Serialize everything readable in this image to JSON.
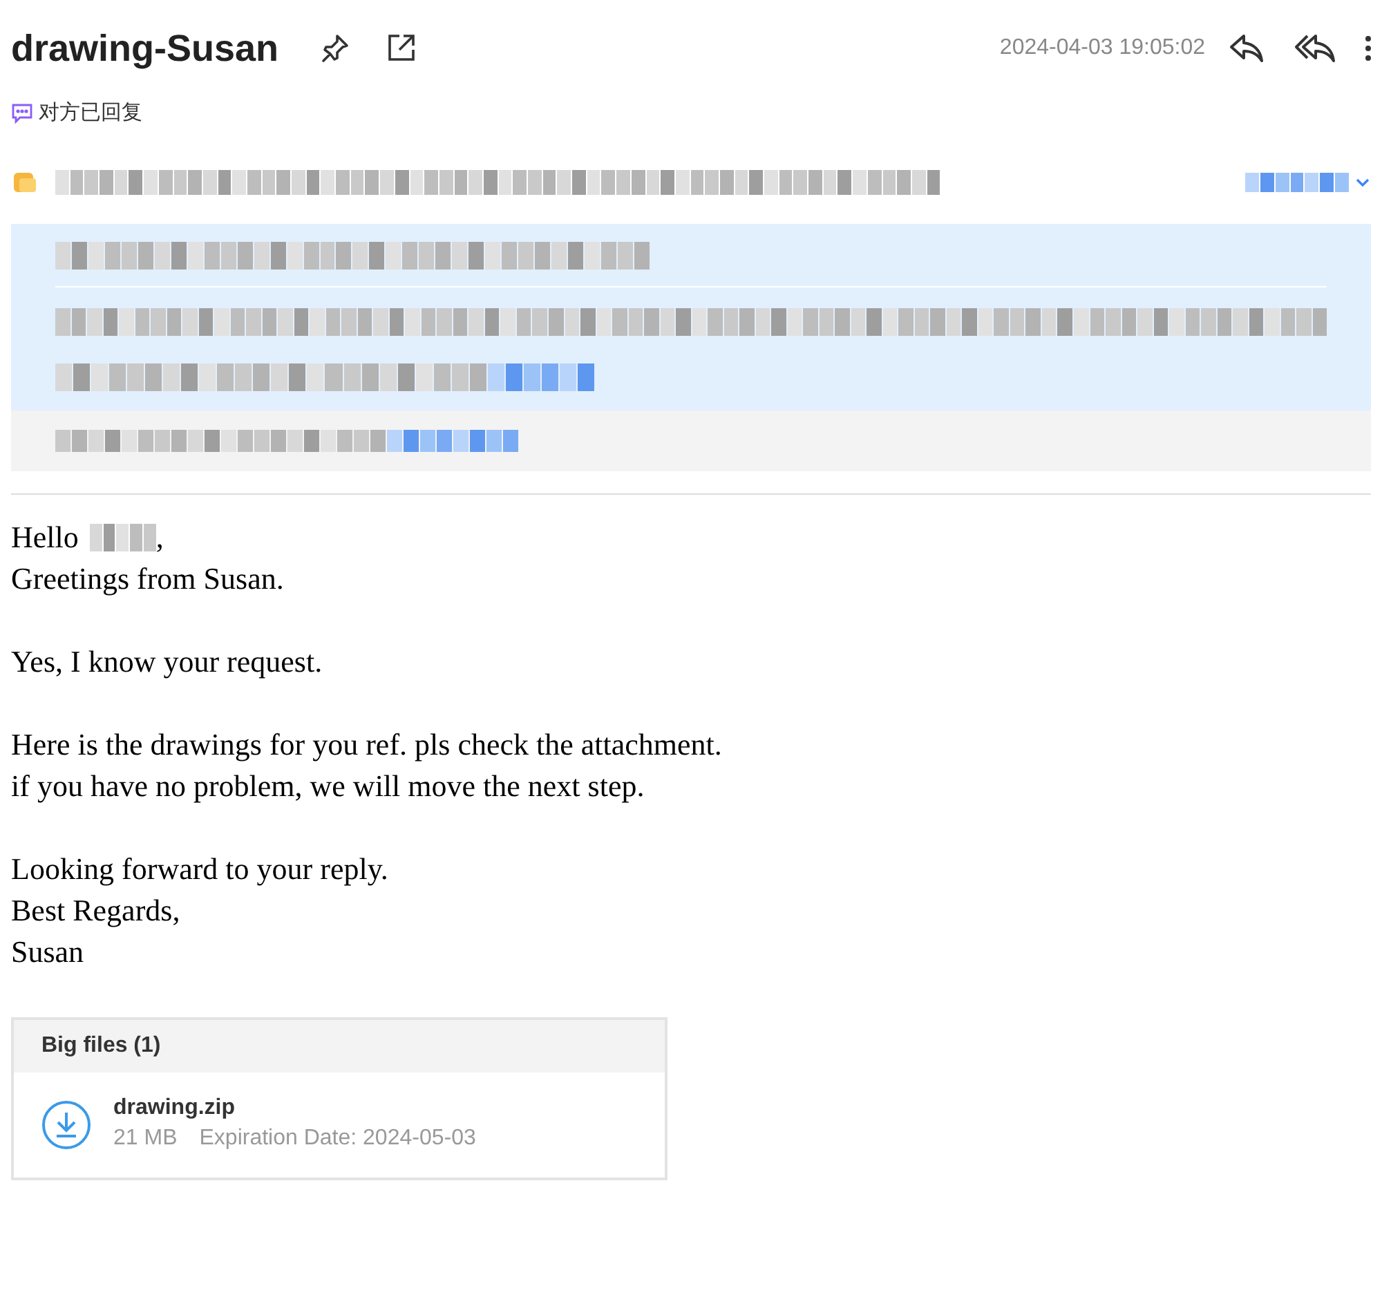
{
  "header": {
    "subject": "drawing-Susan",
    "datetime": "2024-04-03 19:05:02"
  },
  "reply_status": "对方已回复",
  "body": {
    "greeting": [
      "Hello",
      ","
    ],
    "paragraphs": [
      [
        "Greetings from Susan."
      ],
      [
        "Yes, I know your request."
      ],
      [
        "Here is the drawings for you ref. pls check the attachment.",
        "if you have no problem, we will move the next step."
      ],
      [
        "Looking forward to your reply.",
        "Best Regards,",
        "Susan"
      ]
    ]
  },
  "big_files": {
    "title": "Big files (1)",
    "files": [
      {
        "name": "drawing.zip",
        "size": "21 MB",
        "expiration": "Expiration Date: 2024-05-03"
      }
    ]
  }
}
